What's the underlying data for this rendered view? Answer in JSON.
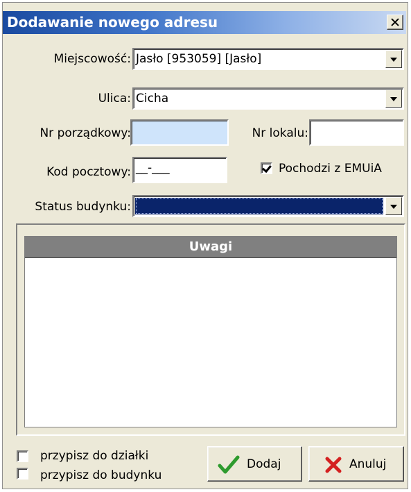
{
  "window": {
    "title": "Dodawanie nowego adresu"
  },
  "form": {
    "miejscowosc": {
      "label": "Miejscowość:",
      "value": "Jasło [953059] [Jasło]"
    },
    "ulica": {
      "label": "Ulica:",
      "value": "Cicha"
    },
    "nr_porzadkowy": {
      "label": "Nr porządkowy:",
      "value": ""
    },
    "nr_lokalu": {
      "label": "Nr lokalu:",
      "value": ""
    },
    "kod_pocztowy": {
      "label": "Kod pocztowy:",
      "value": "__-___"
    },
    "pochodzi_emuia": {
      "label": "Pochodzi z EMUiA",
      "checked": true
    },
    "status_budynku": {
      "label": "Status budynku:",
      "value": ""
    }
  },
  "uwagi": {
    "header": "Uwagi",
    "text": ""
  },
  "footer": {
    "przypisz_dzialki": {
      "label": "przypisz do działki",
      "checked": false
    },
    "przypisz_budynku": {
      "label": "przypisz do budynku",
      "checked": false
    },
    "dodaj_label": "Dodaj",
    "anuluj_label": "Anuluj"
  },
  "icons": {
    "close": "close-icon",
    "dodaj": "checkmark-icon",
    "anuluj": "cross-icon"
  },
  "colors": {
    "title_bar": "#1a4aa0",
    "selection": "#0a246a",
    "nr_porzadkowy_bg": "#cfe4fb",
    "dodaj_icon": "#2e9b2e",
    "anuluj_icon": "#d42020"
  }
}
